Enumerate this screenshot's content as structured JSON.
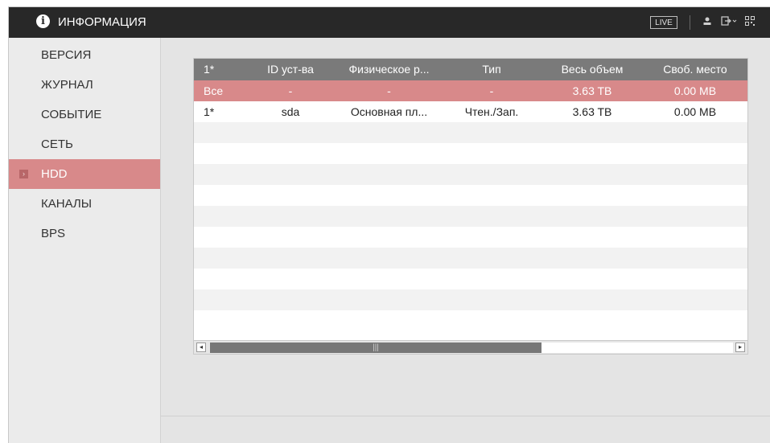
{
  "header": {
    "title": "ИНФОРМАЦИЯ",
    "title_icon": "info-icon",
    "live_label": "LIVE",
    "icons": [
      "user-icon",
      "logout-icon",
      "qr-code-icon"
    ]
  },
  "sidebar": {
    "items": [
      {
        "label": "ВЕРСИЯ",
        "active": false
      },
      {
        "label": "ЖУРНАЛ",
        "active": false
      },
      {
        "label": "СОБЫТИЕ",
        "active": false
      },
      {
        "label": "СЕТЬ",
        "active": false
      },
      {
        "label": "HDD",
        "active": true
      },
      {
        "label": "КАНАЛЫ",
        "active": false
      },
      {
        "label": "BPS",
        "active": false
      }
    ]
  },
  "table": {
    "columns": [
      "1*",
      "ID уст-ва",
      "Физическое р...",
      "Тип",
      "Весь объем",
      "Своб. место"
    ],
    "rows": [
      [
        "Все",
        "-",
        "-",
        "-",
        "3.63 TB",
        "0.00 MB"
      ],
      [
        "1*",
        "sda",
        "Основная пл...",
        "Чтен./Зап.",
        "3.63 TB",
        "0.00 MB"
      ]
    ],
    "selected_row": 0
  },
  "scrollbar": {
    "thumb_grip": "|||",
    "left_arrow": "◂",
    "right_arrow": "▸"
  },
  "colors": {
    "topbar": "#282828",
    "accent": "#d8898a",
    "header_row": "#7a7a7a"
  }
}
